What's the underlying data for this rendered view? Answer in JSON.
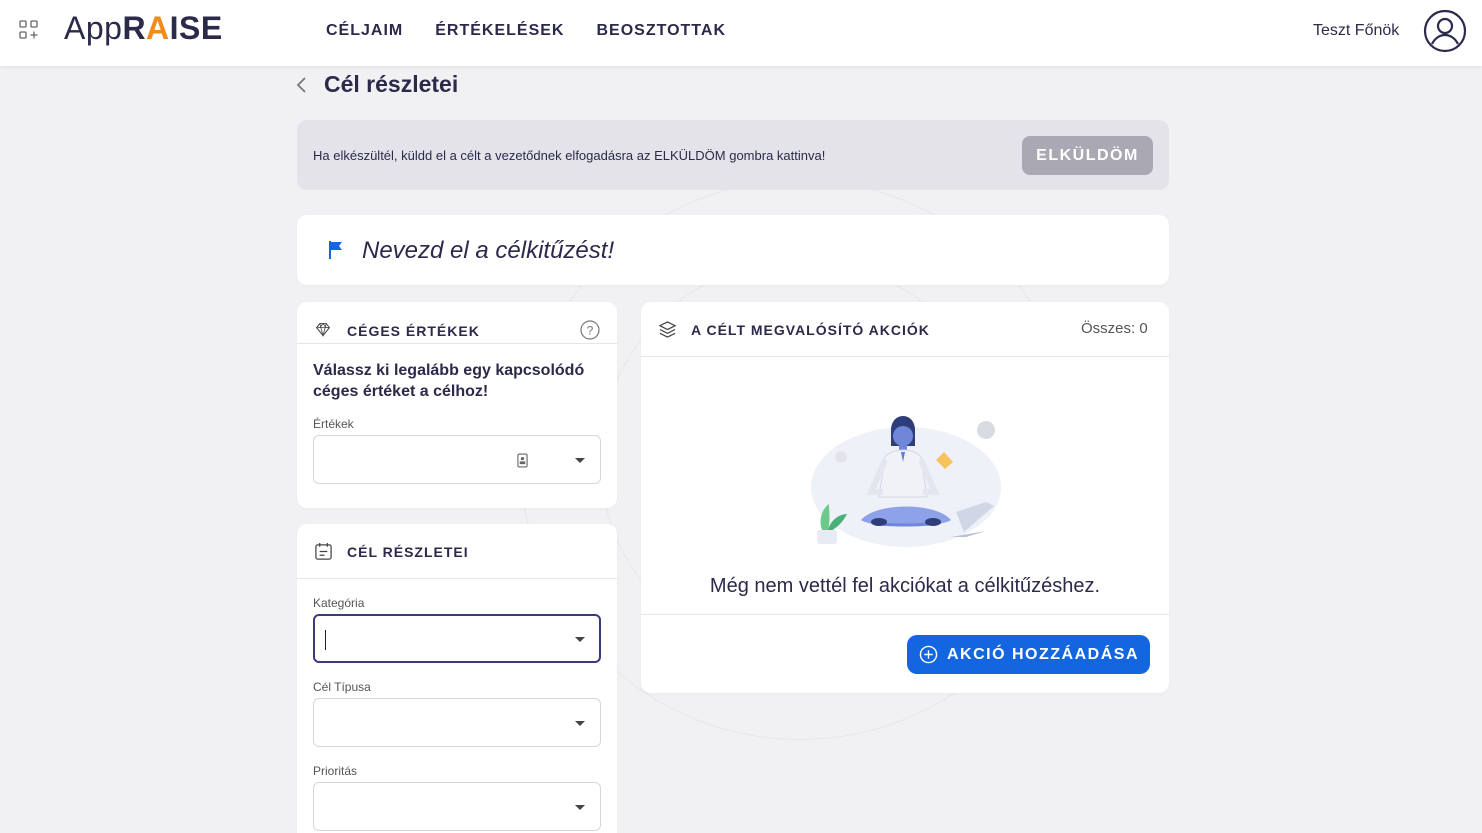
{
  "header": {
    "logo_part1": "App",
    "logo_part2": "R",
    "logo_accent": "A",
    "logo_part3": "ISE",
    "nav": [
      {
        "label": "CÉLJAIM"
      },
      {
        "label": "ÉRTÉKELÉSEK"
      },
      {
        "label": "BEOSZTOTTAK"
      }
    ],
    "user_name": "Teszt Főnök"
  },
  "page": {
    "title": "Cél részletei"
  },
  "banner": {
    "text": "Ha elkészültél, küldd el a célt a vezetődnek elfogadásra az ELKÜLDÖM gombra kattinva!",
    "button_label": "ELKÜLDÖM"
  },
  "goal_name": {
    "placeholder": "Nevezd el a célkitűzést!"
  },
  "company_values": {
    "title": "CÉGES ÉRTÉKEK",
    "prompt": "Válassz ki legalább egy kapcsolódó céges értéket a célhoz!",
    "field_label": "Értékek",
    "value": ""
  },
  "goal_details": {
    "title": "CÉL RÉSZLETEI",
    "fields": [
      {
        "label": "Kategória",
        "value": ""
      },
      {
        "label": "Cél Típusa",
        "value": ""
      },
      {
        "label": "Prioritás",
        "value": ""
      }
    ]
  },
  "actions": {
    "title": "A CÉLT MEGVALÓSÍTÓ AKCIÓK",
    "total": "Összes: 0",
    "empty_text": "Még nem vettél fel akciókat a célkitűzéshez.",
    "add_button_label": "AKCIÓ HOZZÁADÁSA"
  },
  "colors": {
    "primary": "#1366e0",
    "accent": "#f28b1b",
    "text": "#2b2a4a",
    "disabled_button": "#a9a8b3",
    "background": "#f1f1f4"
  },
  "icons": [
    "apps-grid-icon",
    "user-avatar-icon",
    "chevron-left-icon",
    "flag-icon",
    "diamond-icon",
    "help-icon",
    "calendar-icon",
    "layers-icon",
    "plus-circle-icon",
    "contact-card-icon",
    "caret-down-icon"
  ]
}
